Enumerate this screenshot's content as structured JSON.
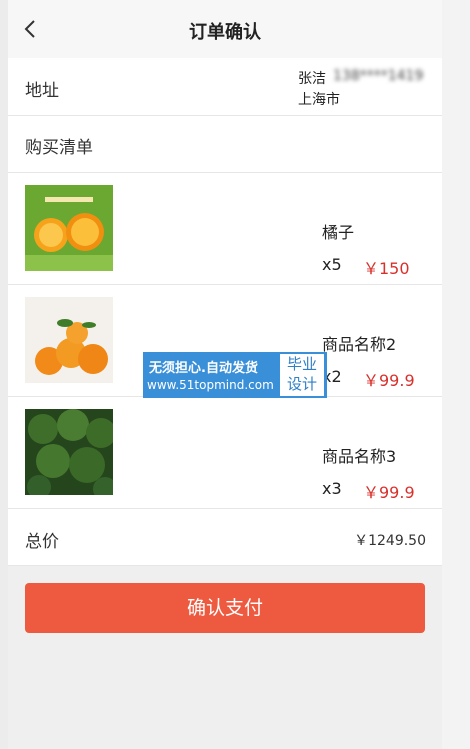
{
  "header": {
    "title": "订单确认",
    "back_icon": "chevron-left-icon"
  },
  "address": {
    "label": "地址",
    "name": "张洁",
    "phone": "138****1419",
    "city": "上海市"
  },
  "cart": {
    "label": "购买清单",
    "items": [
      {
        "name": "橘子",
        "qty": "x5",
        "price": "￥150",
        "image": "oranges-gift-box"
      },
      {
        "name": "商品名称2",
        "qty": "x2",
        "price": "￥99.9",
        "image": "tangerines"
      },
      {
        "name": "商品名称3",
        "qty": "x3",
        "price": "￥99.9",
        "image": "broccoli"
      }
    ]
  },
  "total": {
    "label": "总价",
    "value": "￥1249.50"
  },
  "pay_button": {
    "label": "确认支付"
  },
  "watermark": {
    "line1": "无须担心.自动发货",
    "line2": "www.51topmind.com",
    "badge1": "毕业",
    "badge2": "设计"
  },
  "colors": {
    "price": "#d9302c",
    "pay_button": "#ee5a3f",
    "watermark": "#3a8fd9"
  }
}
